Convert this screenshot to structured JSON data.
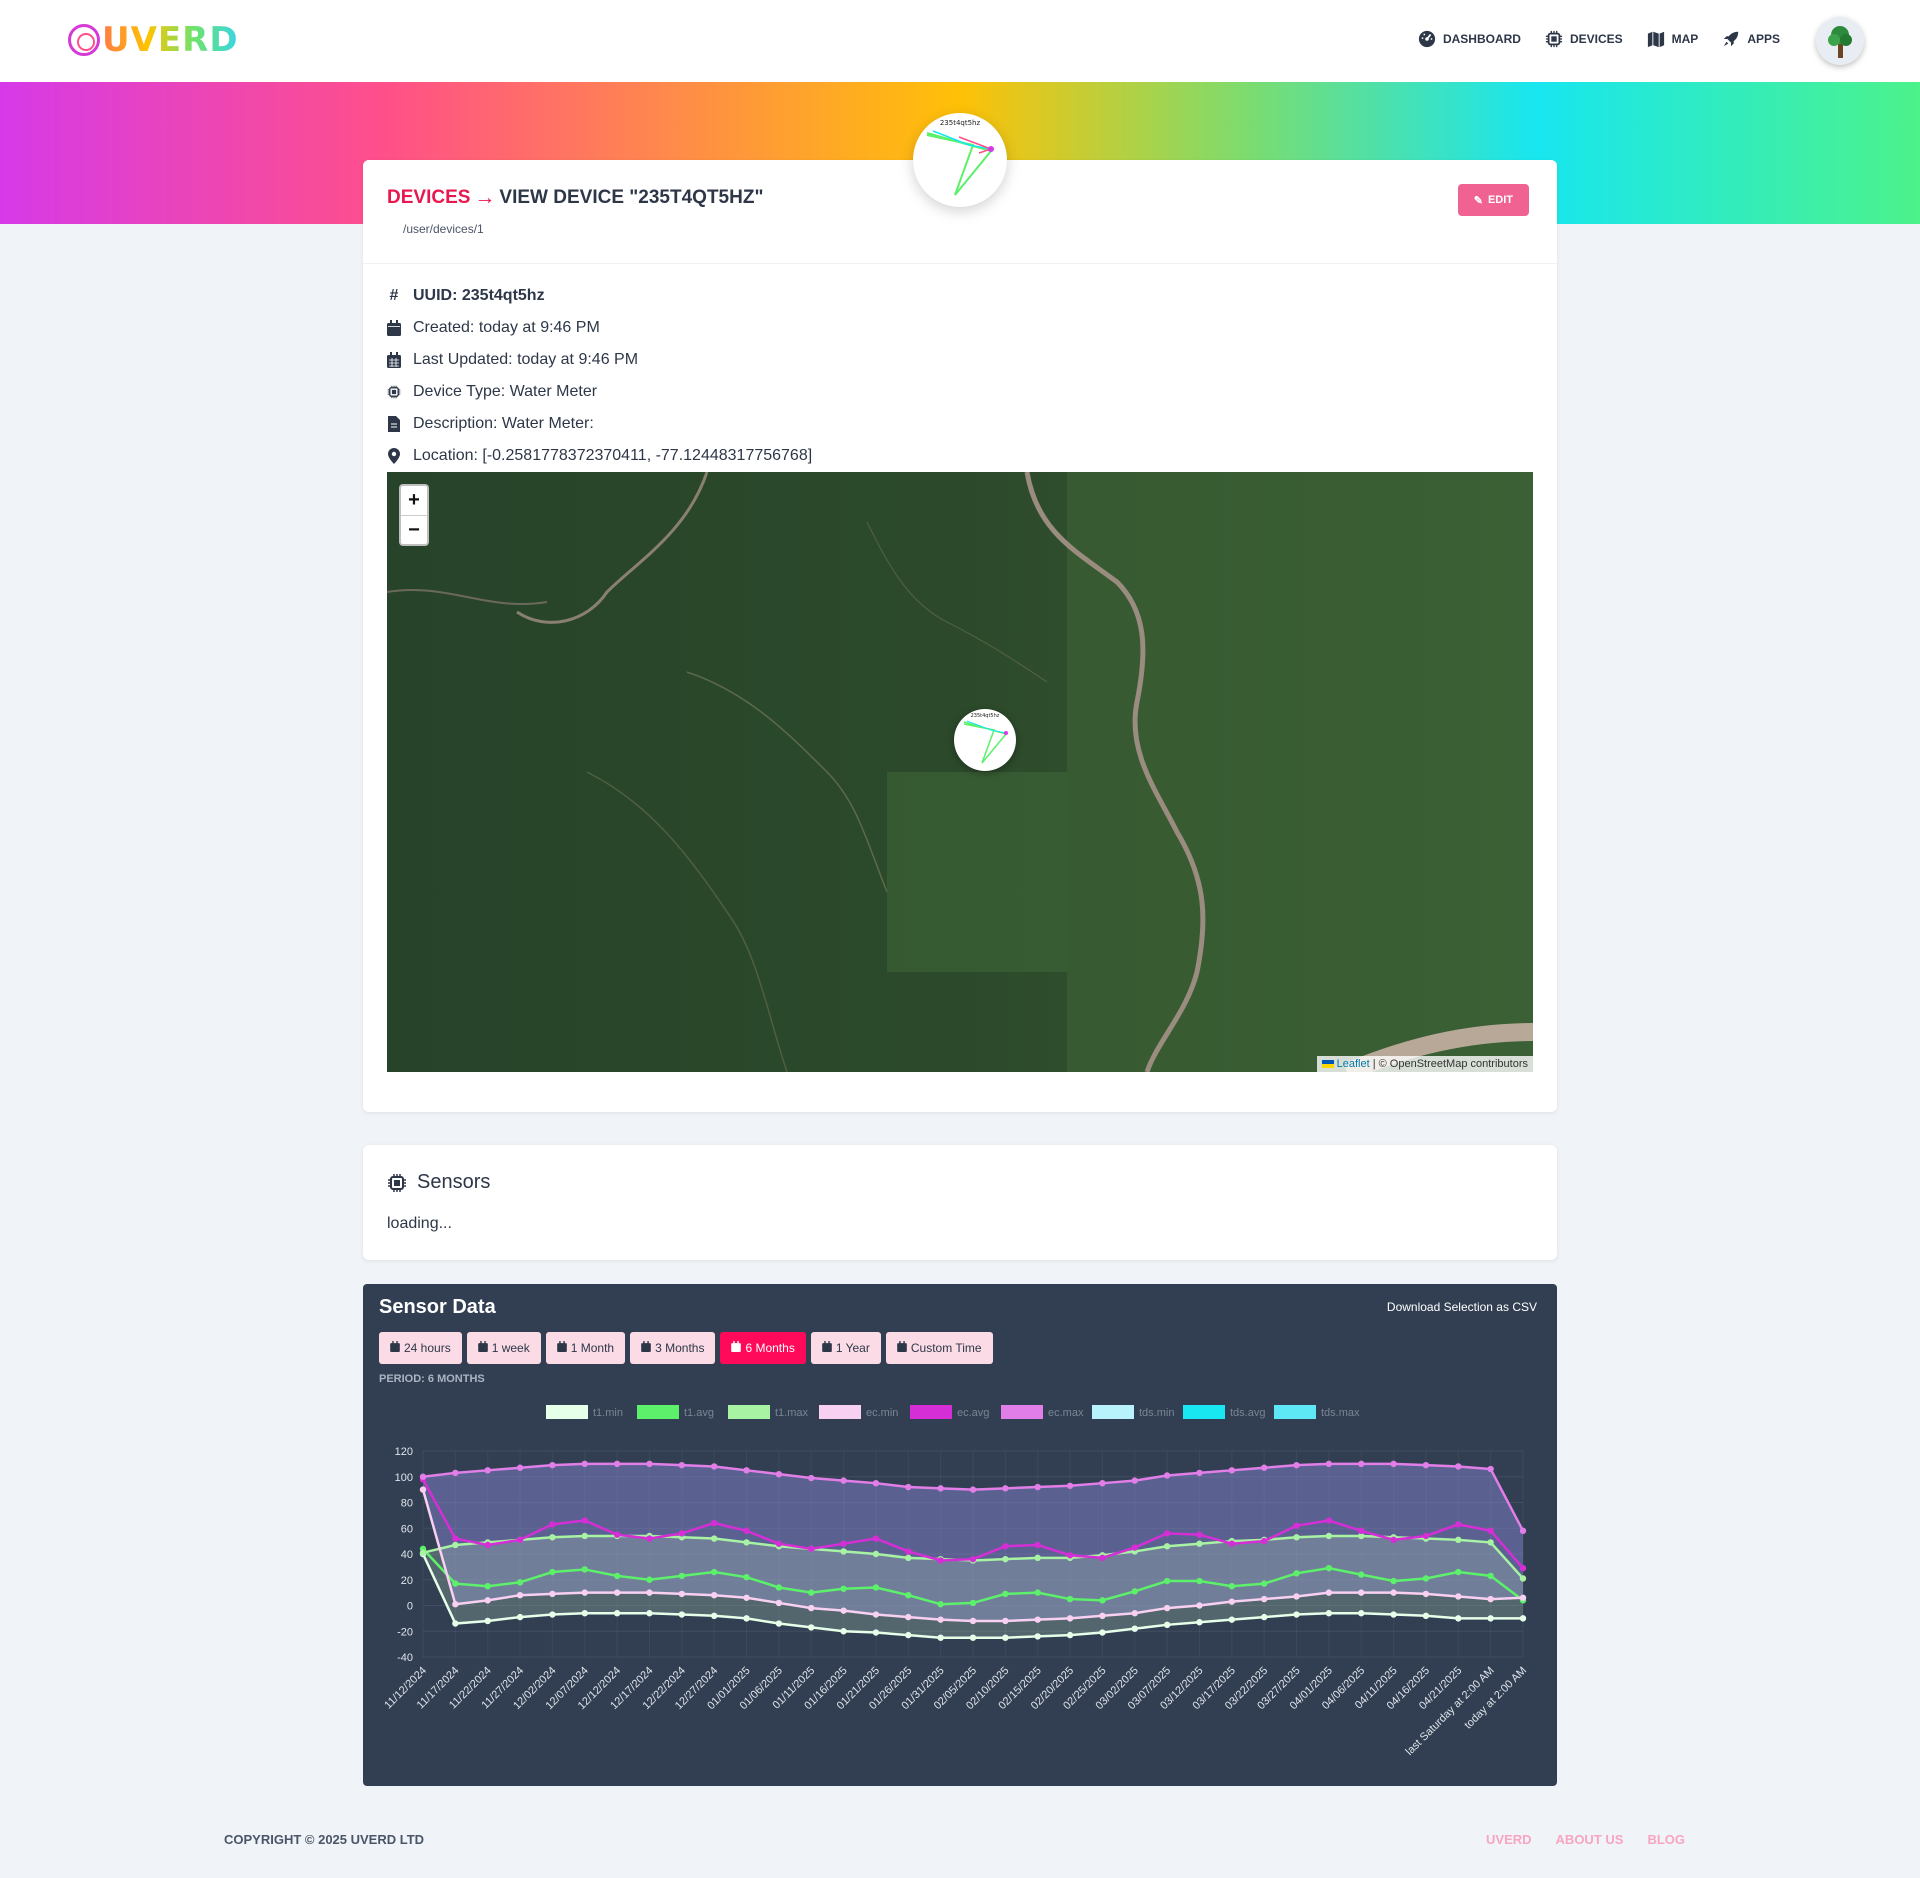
{
  "brand": {
    "name": "UVERD"
  },
  "nav": {
    "items": [
      {
        "label": "DASHBOARD",
        "icon": "gauge-icon"
      },
      {
        "label": "DEVICES",
        "icon": "chip-icon"
      },
      {
        "label": "MAP",
        "icon": "map-icon"
      },
      {
        "label": "APPS",
        "icon": "rocket-icon"
      }
    ],
    "avatar": "tree-avatar"
  },
  "device": {
    "breadcrumb_root": "DEVICES",
    "title": "VIEW DEVICE \"235T4QT5HZ\"",
    "path": "/user/devices/1",
    "edit_label": "EDIT",
    "badge_label": "235t4qt5hz",
    "info": {
      "uuid": "UUID: 235t4qt5hz",
      "created": "Created: today at 9:46 PM",
      "updated": "Last Updated: today at 9:46 PM",
      "type": "Device Type: Water Meter",
      "description": "Description: Water Meter:",
      "location": "Location: [-0.2581778372370411, -77.12448317756768]"
    }
  },
  "map": {
    "zoom_in": "+",
    "zoom_out": "−",
    "attribution_link": "Leaflet",
    "attribution_rest": " | © OpenStreetMap contributors",
    "marker_label": "235t4qt5hz"
  },
  "sensors": {
    "title": "Sensors",
    "status": "loading..."
  },
  "sensor_data": {
    "title": "Sensor Data",
    "download_label": "Download Selection as CSV",
    "ranges": [
      "24 hours",
      "1 week",
      "1 Month",
      "3 Months",
      "6 Months",
      "1 Year",
      "Custom Time"
    ],
    "active_range": "6 Months",
    "period": "PERIOD: 6 MONTHS"
  },
  "chart_data": {
    "type": "line",
    "ylim": [
      -40,
      120
    ],
    "yticks": [
      120,
      100,
      80,
      60,
      40,
      20,
      0,
      -20,
      -40
    ],
    "grid": true,
    "legend_position": "top",
    "categories": [
      "11/12/2024",
      "11/17/2024",
      "11/22/2024",
      "11/27/2024",
      "12/02/2024",
      "12/07/2024",
      "12/12/2024",
      "12/17/2024",
      "12/22/2024",
      "12/27/2024",
      "01/01/2025",
      "01/06/2025",
      "01/11/2025",
      "01/16/2025",
      "01/21/2025",
      "01/26/2025",
      "01/31/2025",
      "02/05/2025",
      "02/10/2025",
      "02/15/2025",
      "02/20/2025",
      "02/25/2025",
      "03/02/2025",
      "03/07/2025",
      "03/12/2025",
      "03/17/2025",
      "03/22/2025",
      "03/27/2025",
      "04/01/2025",
      "04/06/2025",
      "04/11/2025",
      "04/16/2025",
      "04/21/2025",
      "last Saturday at 2:00 AM",
      "today at 2:00 AM"
    ],
    "series": [
      {
        "name": "t1.min",
        "color": "#e6ffe9",
        "values": [
          40,
          -14,
          -12,
          -9,
          -7,
          -6,
          -6,
          -6,
          -7,
          -8,
          -10,
          -14,
          -17,
          -20,
          -21,
          -23,
          -25,
          -25,
          -25,
          -24,
          -23,
          -21,
          -18,
          -15,
          -13,
          -11,
          -9,
          -7,
          -6,
          -6,
          -7,
          -8,
          -10,
          -10,
          -10
        ]
      },
      {
        "name": "t1.avg",
        "color": "#5cf06b",
        "values": [
          44,
          17,
          15,
          18,
          26,
          28,
          23,
          20,
          23,
          26,
          22,
          14,
          10,
          13,
          14,
          8,
          1,
          2,
          9,
          10,
          5,
          4,
          11,
          19,
          19,
          15,
          17,
          25,
          29,
          24,
          19,
          21,
          26,
          23,
          4
        ]
      },
      {
        "name": "t1.max",
        "color": "#a8f2a4",
        "values": [
          41,
          47,
          49,
          51,
          53,
          54,
          54,
          54,
          53,
          52,
          49,
          46,
          44,
          42,
          40,
          37,
          36,
          35,
          36,
          37,
          37,
          39,
          42,
          46,
          48,
          50,
          51,
          53,
          54,
          54,
          53,
          52,
          51,
          49,
          21
        ]
      },
      {
        "name": "ec.min",
        "color": "#f8d0f2",
        "values": [
          90,
          1,
          4,
          8,
          9,
          10,
          10,
          10,
          9,
          8,
          6,
          2,
          -2,
          -4,
          -7,
          -9,
          -11,
          -12,
          -12,
          -11,
          -10,
          -8,
          -6,
          -2,
          0,
          3,
          5,
          7,
          10,
          10,
          10,
          9,
          7,
          5,
          6
        ]
      },
      {
        "name": "ec.avg",
        "color": "#d62ed6",
        "values": [
          98,
          52,
          47,
          51,
          63,
          66,
          55,
          52,
          56,
          64,
          58,
          48,
          44,
          48,
          52,
          42,
          35,
          36,
          46,
          47,
          39,
          37,
          45,
          56,
          55,
          48,
          50,
          62,
          66,
          58,
          51,
          54,
          63,
          58,
          29
        ]
      },
      {
        "name": "ec.max",
        "color": "#e27ee8",
        "values": [
          100,
          103,
          105,
          107,
          109,
          110,
          110,
          110,
          109,
          108,
          105,
          102,
          99,
          97,
          95,
          92,
          91,
          90,
          91,
          92,
          93,
          95,
          97,
          101,
          103,
          105,
          107,
          109,
          110,
          110,
          110,
          109,
          108,
          106,
          58
        ]
      },
      {
        "name": "tds.min",
        "color": "#b8f2fa",
        "values": []
      },
      {
        "name": "tds.avg",
        "color": "#18e6f0",
        "values": []
      },
      {
        "name": "tds.max",
        "color": "#5ee8f5",
        "values": []
      }
    ]
  },
  "footer": {
    "copyright": "COPYRIGHT © 2025 UVERD LTD",
    "links": [
      "UVERD",
      "ABOUT US",
      "BLOG"
    ]
  }
}
